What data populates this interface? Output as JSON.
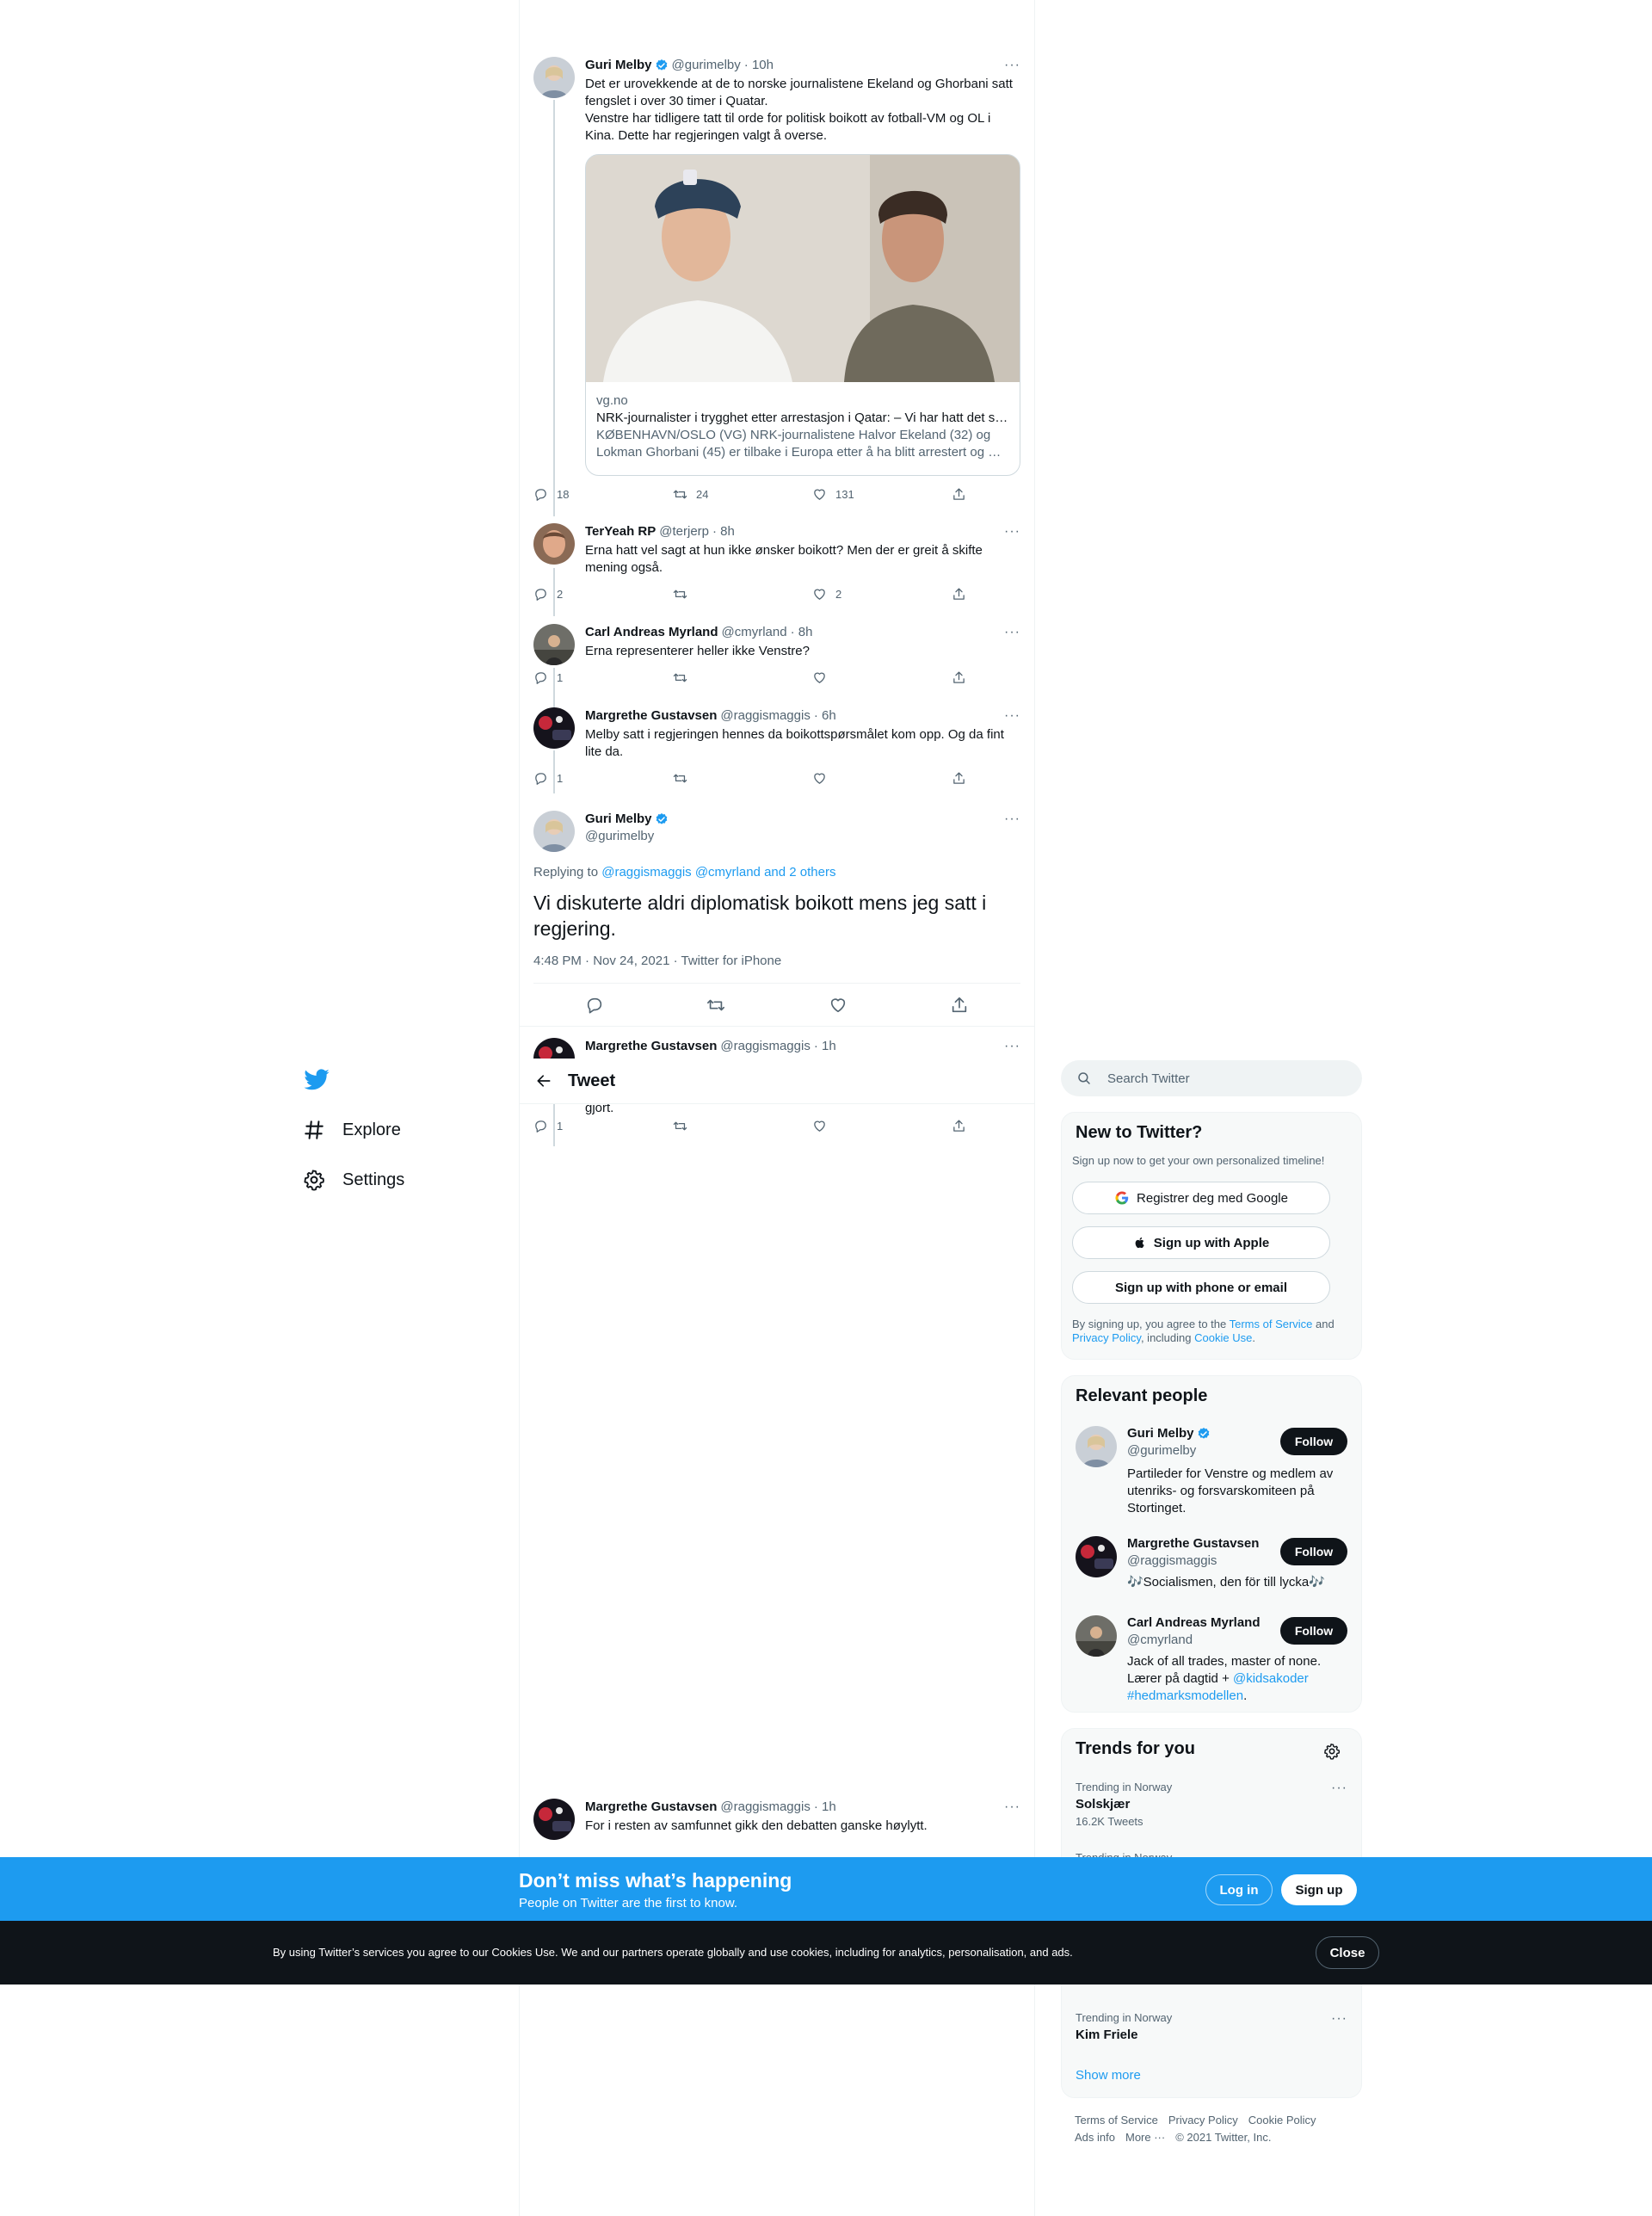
{
  "nav": {
    "explore": "Explore",
    "settings": "Settings"
  },
  "header": {
    "title": "Tweet"
  },
  "thread": {
    "t1": {
      "name": "Guri Melby",
      "handle": "@gurimelby",
      "time": "· 10h",
      "text": "Det er urovekkende at de to norske journalistene Ekeland og Ghorbani satt fengslet i over 30 timer i Quatar.\nVenstre har tidligere tatt til orde for politisk boikott av fotball-VM og OL i Kina. Dette har regjeringen valgt å overse.",
      "card": {
        "domain": "vg.no",
        "title": "NRK-journalister i trygghet etter arrestasjon i Qatar: – Vi har hatt det sl…",
        "desc": "KØBENHAVN/OSLO (VG) NRK-journalistene Halvor Ekeland (32) og Lokman Ghorbani (45) er tilbake i Europa etter å ha blitt arrestert og …"
      },
      "replies": "18",
      "retweets": "24",
      "likes": "131"
    },
    "t2": {
      "name": "TerYeah RP",
      "handle": "@terjerp",
      "time": "· 8h",
      "text": "Erna hatt vel sagt at hun ikke ønsker boikott? Men der er greit å skifte mening også.",
      "replies": "2",
      "retweets": "",
      "likes": "2"
    },
    "t3": {
      "name": "Carl Andreas Myrland",
      "handle": "@cmyrland",
      "time": "· 8h",
      "text": "Erna representerer heller ikke Venstre?",
      "replies": "1",
      "retweets": "",
      "likes": ""
    },
    "t4": {
      "name": "Margrethe Gustavsen",
      "handle": "@raggismaggis",
      "time": "· 6h",
      "text": "Melby satt i regjeringen hennes da boikottspørsmålet kom opp. Og da fint lite da.",
      "replies": "1",
      "retweets": "",
      "likes": ""
    },
    "main": {
      "name": "Guri Melby",
      "handle": "@gurimelby",
      "replying_prefix": "Replying to ",
      "replying_to": "@raggismaggis @cmyrland and 2 others",
      "text": "Vi diskuterte aldri diplomatisk boikott mens jeg satt i regjering.",
      "meta": "4:48 PM · Nov 24, 2021 · Twitter for iPhone"
    },
    "t5": {
      "name": "Margrethe Gustavsen",
      "handle": "@raggismaggis",
      "time": "· 1h",
      "text": "gjort.",
      "replies": "1"
    },
    "t6": {
      "name": "Margrethe Gustavsen",
      "handle": "@raggismaggis",
      "time": "· 1h",
      "text": "For i resten av samfunnet gikk den debatten ganske høylytt."
    }
  },
  "right": {
    "search_placeholder": "Search Twitter",
    "new": {
      "title": "New to Twitter?",
      "sub": "Sign up now to get your own personalized timeline!",
      "google": "Registrer deg med Google",
      "apple": "Sign up with Apple",
      "phone": "Sign up with phone or email",
      "terms_1": "By signing up, you agree to the ",
      "terms_tos": "Terms of Service",
      "terms_2": " and ",
      "terms_pp": "Privacy Policy",
      "terms_3": ", including ",
      "terms_cu": "Cookie Use",
      "terms_4": "."
    },
    "relevant": {
      "title": "Relevant people",
      "follow": "Follow",
      "p1": {
        "name": "Guri Melby",
        "handle": "@gurimelby",
        "bio": "Partileder for Venstre og medlem av utenriks- og forsvarskomiteen på Stortinget."
      },
      "p2": {
        "name": "Margrethe Gustavsen",
        "handle": "@raggismaggis",
        "bio": "🎶Socialismen, den för till lycka🎶"
      },
      "p3": {
        "name": "Carl Andreas Myrland",
        "handle": "@cmyrland",
        "bio_1": "Jack of all trades, master of none.",
        "bio_2": "Lærer på dagtid + ",
        "bio_link1": "@kidsakoder",
        "bio_link2": "#hedmarksmodellen",
        "bio_end": "."
      }
    },
    "trends": {
      "title": "Trends for you",
      "t1": {
        "ctx": "Trending in Norway",
        "name": "Solskjær",
        "count": "16.2K Tweets"
      },
      "t2": {
        "ctx": "Trending in Norway"
      },
      "t3": {
        "ctx": "Trending in Norway",
        "name": "Kim Friele"
      },
      "show_more": "Show more"
    },
    "footer": {
      "tos": "Terms of Service",
      "privacy": "Privacy Policy",
      "cookie": "Cookie Policy",
      "ads": "Ads info",
      "more": "More ···",
      "copy": "© 2021 Twitter, Inc."
    }
  },
  "banner": {
    "title": "Don’t miss what’s happening",
    "sub": "People on Twitter are the first to know.",
    "login": "Log in",
    "signup": "Sign up"
  },
  "cookie": {
    "text": "By using Twitter’s services you agree to our Cookies Use. We and our partners operate globally and use cookies, including for analytics, personalisation, and ads.",
    "close": "Close"
  },
  "colors": {
    "accent": "#1d9bf0",
    "text": "#0f1419",
    "muted": "#536471"
  }
}
